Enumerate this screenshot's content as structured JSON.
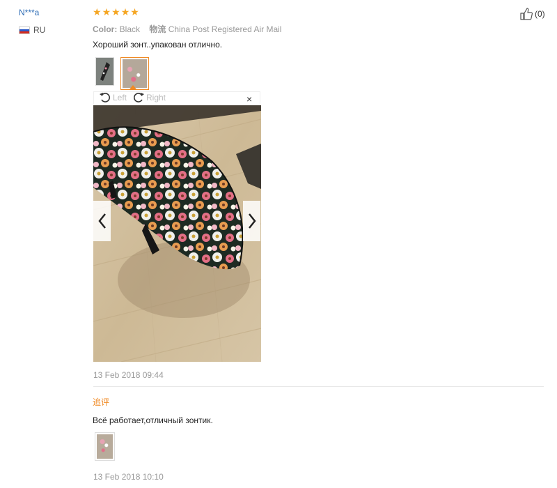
{
  "review": {
    "user_name": "N***a",
    "country": "RU",
    "rating_stars": [
      "★",
      "★",
      "★",
      "★",
      "★"
    ],
    "color_label": "Color:",
    "color_value": "Black",
    "shipping_label": "物流",
    "shipping_value": "China Post Registered Air Mail",
    "text": "Хороший зонт..упакован отлично.",
    "helpful_count": "(0)",
    "date": "13 Feb 2018 09:44"
  },
  "viewer": {
    "rotate_left_label": "Left",
    "rotate_right_label": "Right",
    "close_label": "×"
  },
  "append": {
    "label": "追评",
    "text": "Всё работает,отличный зонтик.",
    "date": "13 Feb 2018 10:10"
  },
  "colors": {
    "accent": "#f08a24",
    "star": "#f5a623",
    "link": "#2d6cb5"
  },
  "icons": {
    "flag": "russia-flag-icon",
    "rotate_left": "rotate-left-icon",
    "rotate_right": "rotate-right-icon",
    "prev": "chevron-left-icon",
    "next": "chevron-right-icon",
    "helpful": "thumbs-up-icon"
  }
}
